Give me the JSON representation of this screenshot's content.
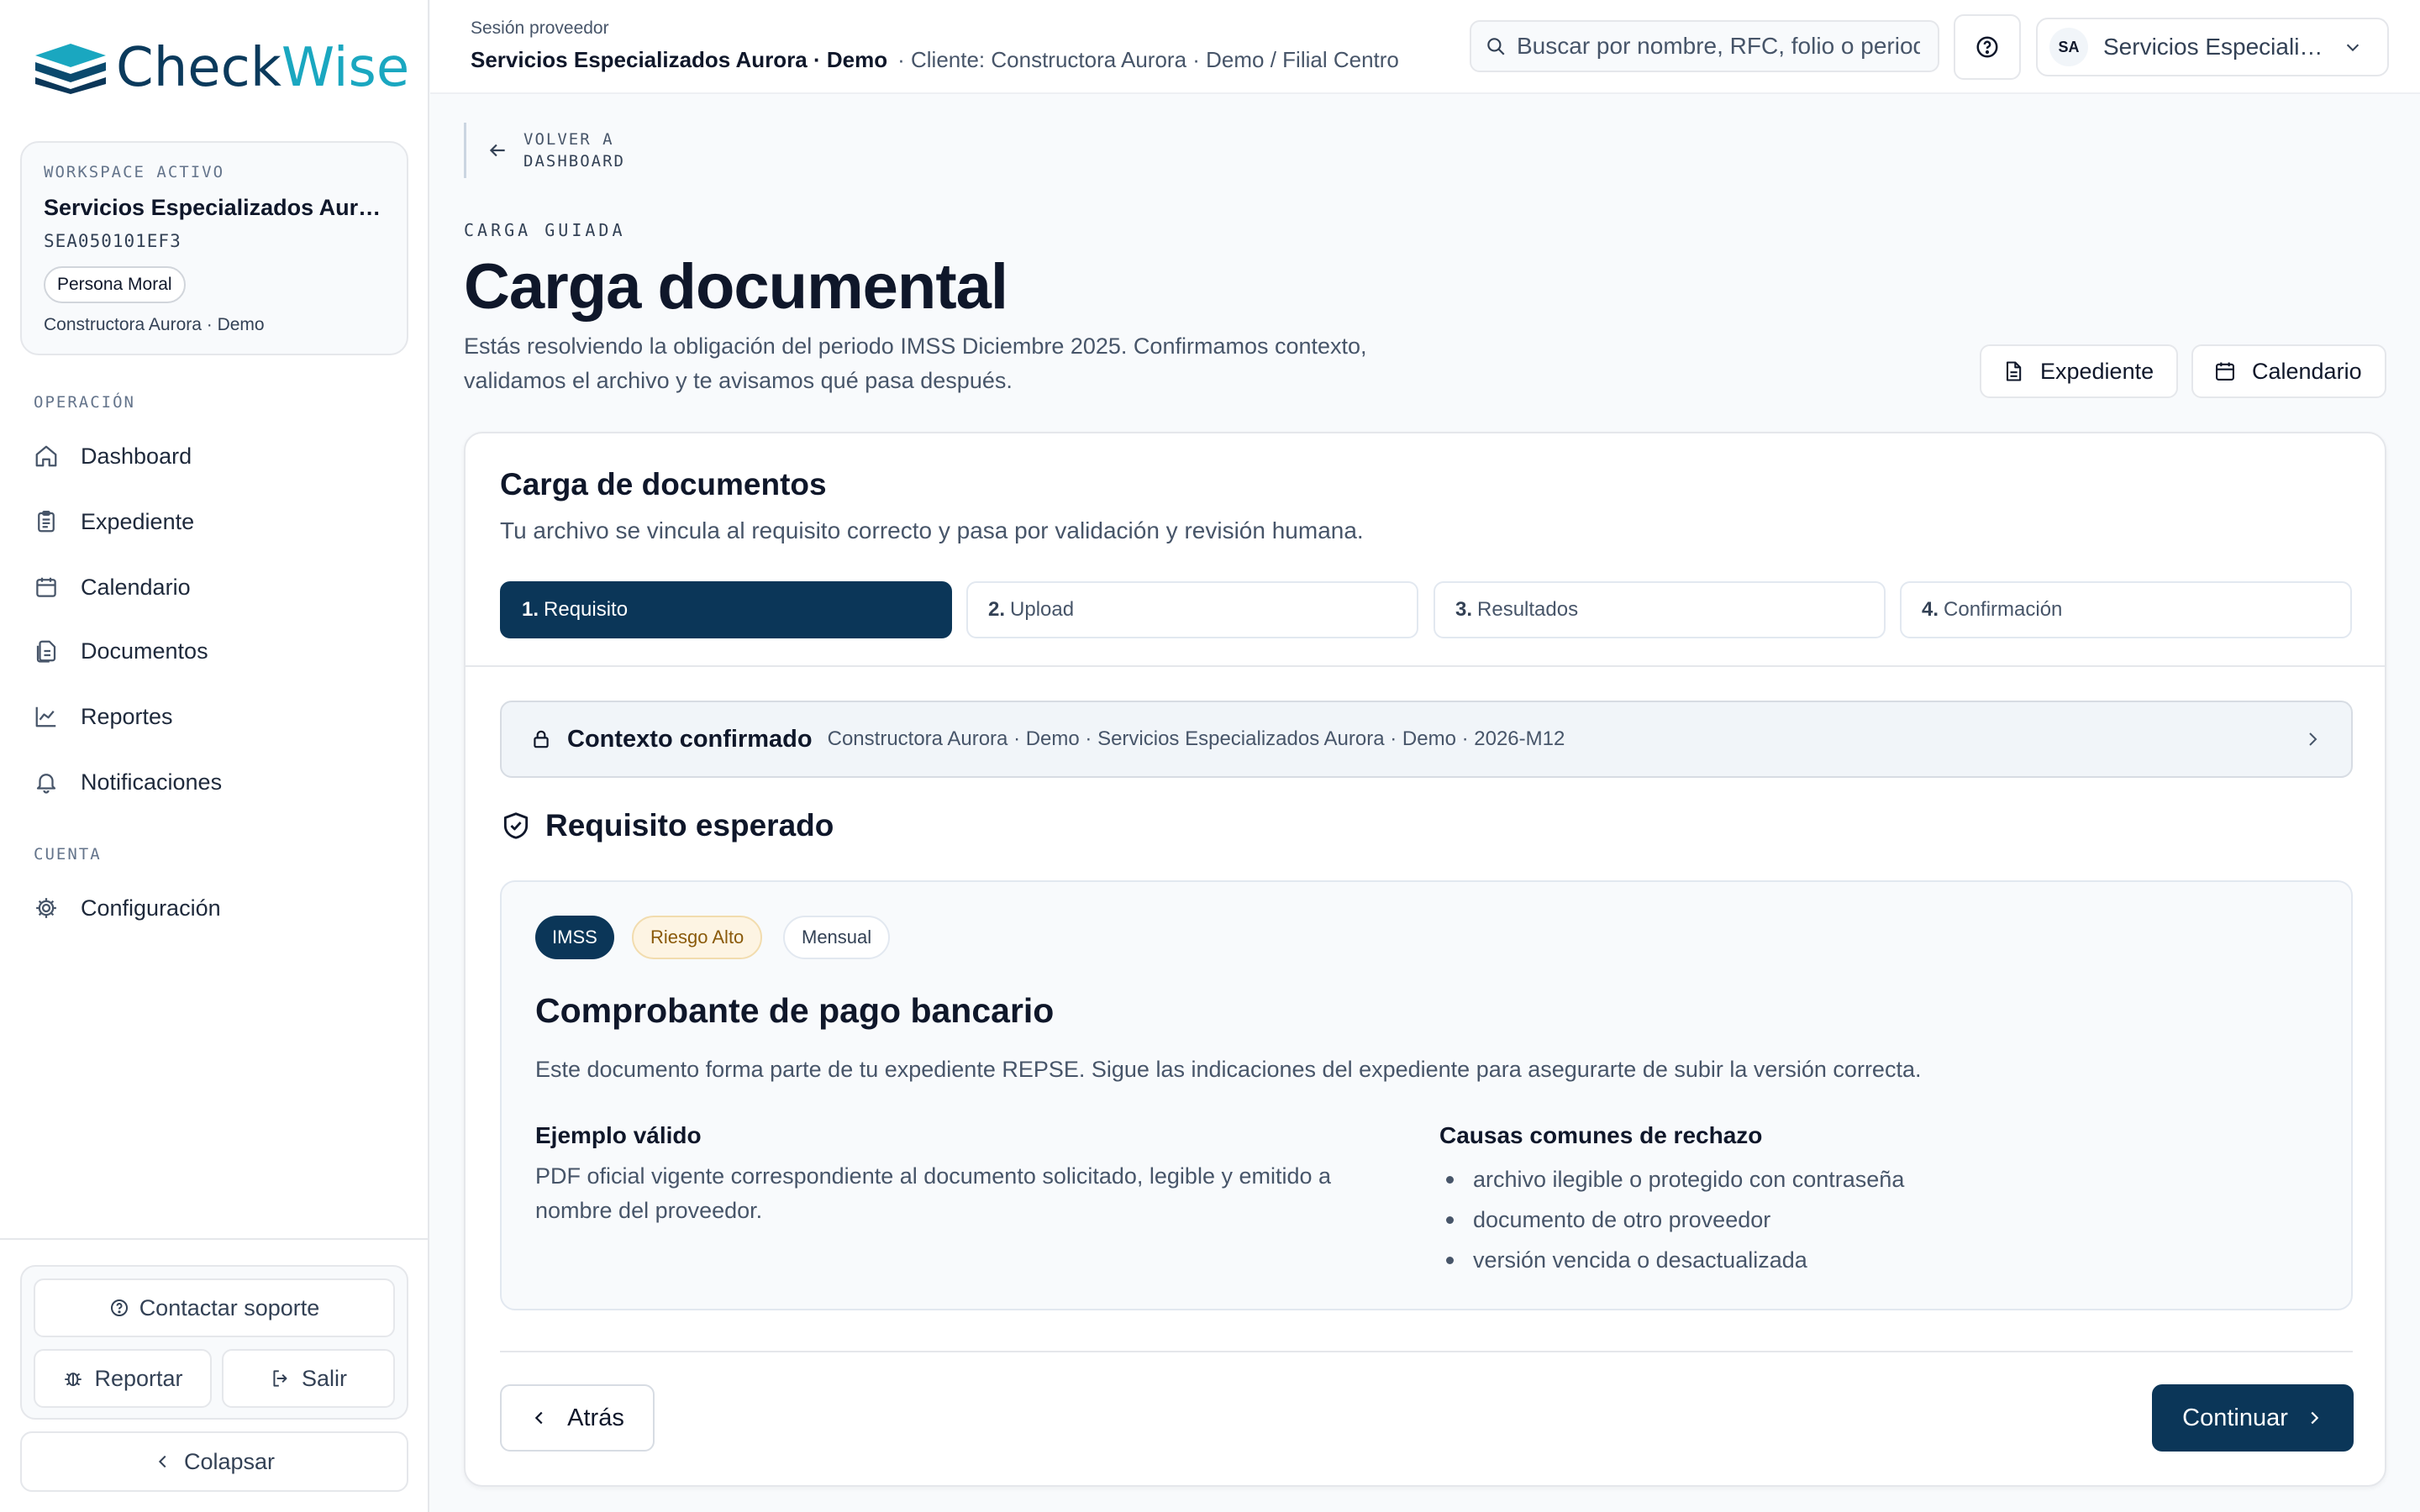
{
  "brand": {
    "name_part1": "Check",
    "name_part2": "Wise"
  },
  "workspace": {
    "kicker": "WORKSPACE ACTIVO",
    "name": "Servicios Especializados Aurora · Demo",
    "rfc": "SEA050101EF3",
    "badge": "Persona Moral",
    "client": "Constructora Aurora · Demo"
  },
  "sidebar": {
    "section_operation": "OPERACIÓN",
    "section_account": "CUENTA",
    "items": [
      {
        "label": "Dashboard",
        "icon": "home-icon"
      },
      {
        "label": "Expediente",
        "icon": "clipboard-icon"
      },
      {
        "label": "Calendario",
        "icon": "calendar-icon"
      },
      {
        "label": "Documentos",
        "icon": "documents-icon"
      },
      {
        "label": "Reportes",
        "icon": "chart-line-icon"
      },
      {
        "label": "Notificaciones",
        "icon": "bell-icon"
      }
    ],
    "settings": {
      "label": "Configuración",
      "icon": "gear-icon"
    },
    "support_label": "Contactar soporte",
    "report_label": "Reportar",
    "logout_label": "Salir",
    "collapse_label": "Colapsar"
  },
  "topbar": {
    "session_kicker": "Sesión proveedor",
    "session_name": "Servicios Especializados Aurora · Demo",
    "session_context": "· Cliente: Constructora Aurora · Demo / Filial Centro",
    "search_placeholder": "Buscar por nombre, RFC, folio o periodo",
    "user_initials": "SA",
    "user_name": "Servicios Especializados Aurora · Demo"
  },
  "page": {
    "back_line1": "VOLVER A",
    "back_line2": "DASHBOARD",
    "kicker": "CARGA GUIADA",
    "title": "Carga documental",
    "description": "Estás resolviendo la obligación del periodo IMSS Diciembre 2025. Confirmamos contexto, validamos el archivo y te avisamos qué pasa después.",
    "btn_expediente": "Expediente",
    "btn_calendario": "Calendario"
  },
  "card": {
    "title": "Carga de documentos",
    "subtitle": "Tu archivo se vincula al requisito correcto y pasa por validación y revisión humana.",
    "steps": [
      {
        "num": "1.",
        "label": "Requisito",
        "active": true
      },
      {
        "num": "2.",
        "label": "Upload",
        "active": false
      },
      {
        "num": "3.",
        "label": "Resultados",
        "active": false
      },
      {
        "num": "4.",
        "label": "Confirmación",
        "active": false
      }
    ],
    "context_label": "Contexto confirmado",
    "context_detail": "Constructora Aurora · Demo · Servicios Especializados Aurora · Demo · 2026-M12",
    "requirement_heading": "Requisito esperado",
    "tags": {
      "authority": "IMSS",
      "risk": "Riesgo Alto",
      "frequency": "Mensual"
    },
    "doc_title": "Comprobante de pago bancario",
    "doc_description": "Este documento forma parte de tu expediente REPSE. Sigue las indicaciones del expediente para asegurarte de subir la versión correcta.",
    "valid_example_heading": "Ejemplo válido",
    "valid_example_text": "PDF oficial vigente correspondiente al documento solicitado, legible y emitido a nombre del proveedor.",
    "rejection_heading": "Causas comunes de rechazo",
    "rejection_reasons": [
      "archivo ilegible o protegido con contraseña",
      "documento de otro proveedor",
      "versión vencida o desactualizada"
    ],
    "btn_back": "Atrás",
    "btn_continue": "Continuar"
  },
  "colors": {
    "primary": "#0b3658",
    "brand_teal": "#1aa7c0",
    "risk_bg": "#fdf4e3",
    "risk_text": "#8a5a0b"
  }
}
